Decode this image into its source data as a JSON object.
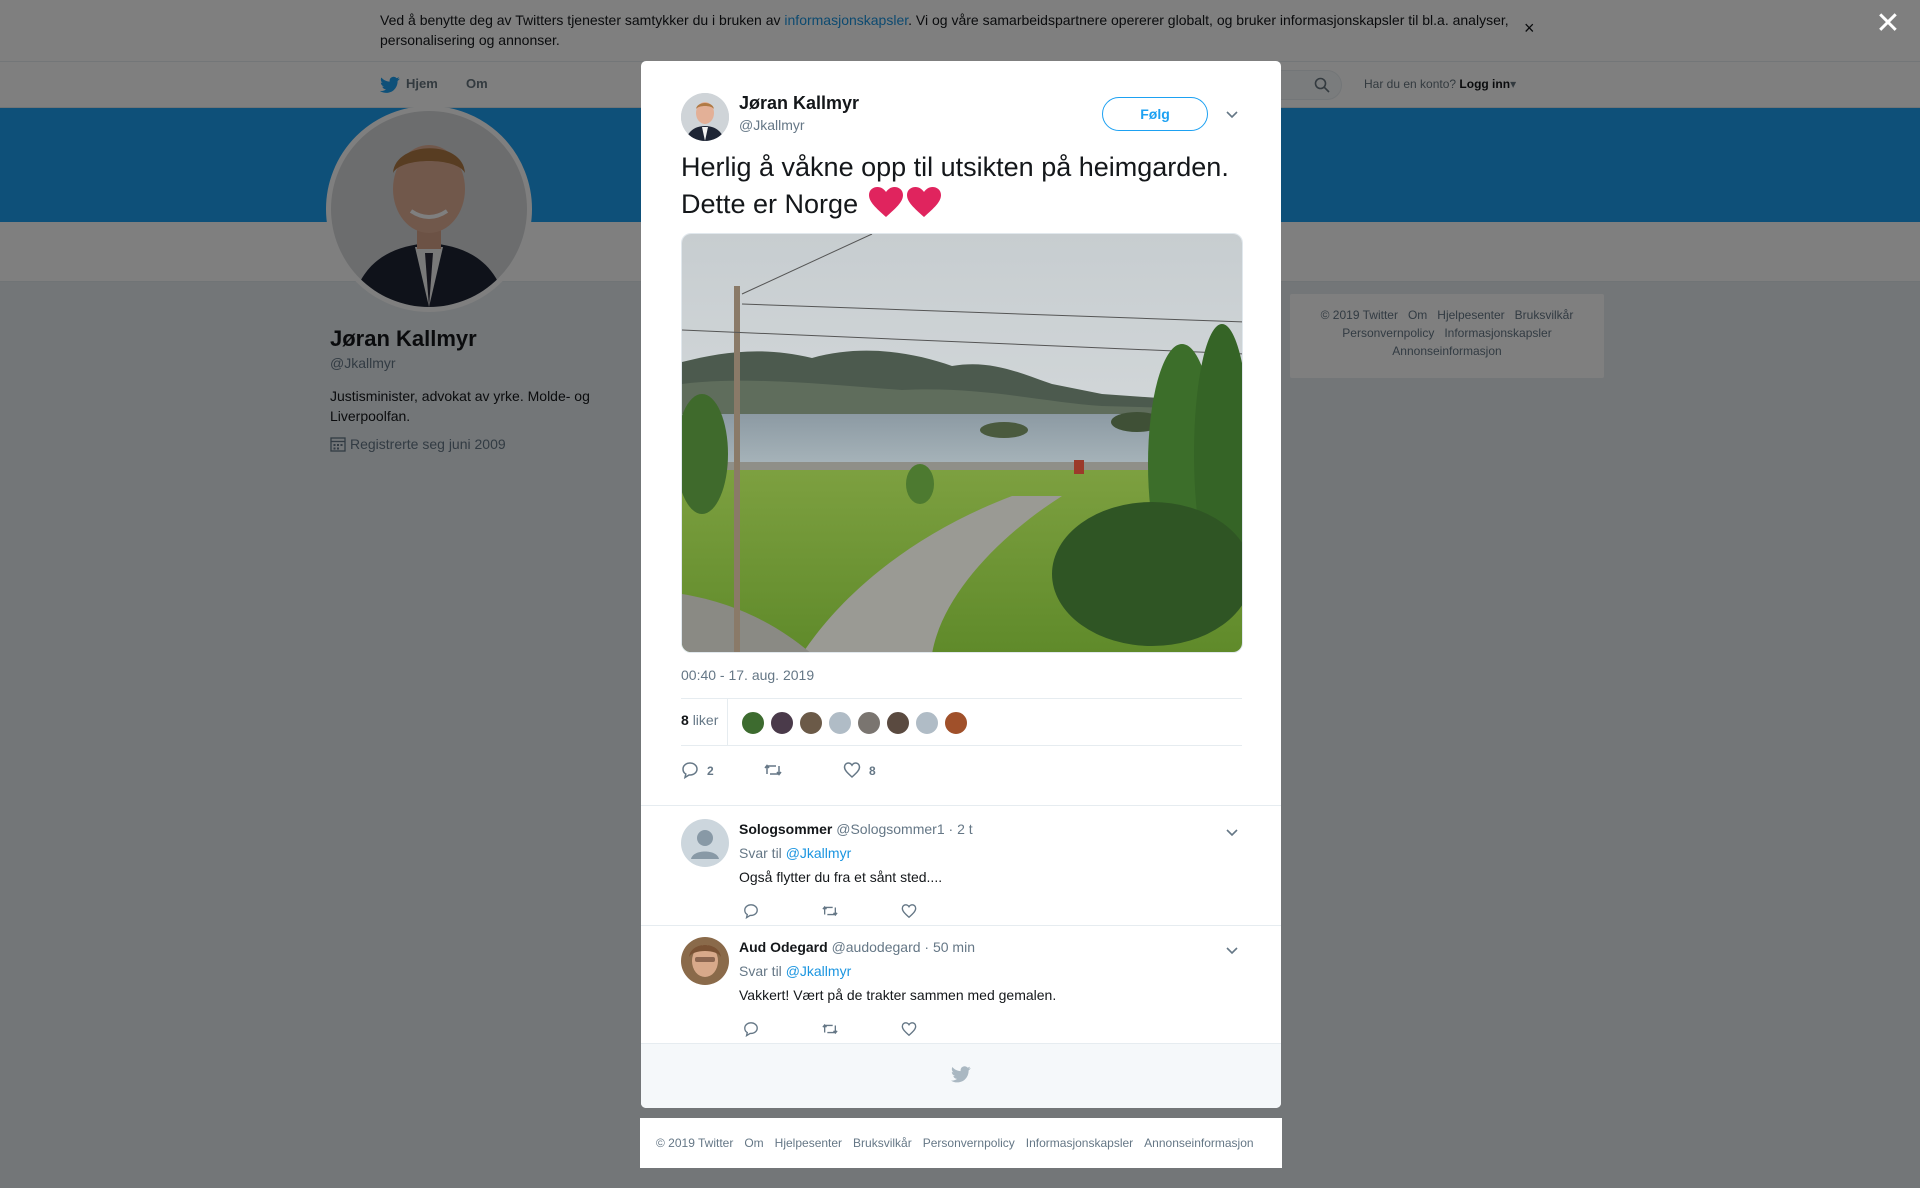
{
  "cookie_banner": {
    "text_before": "Ved å benytte deg av Twitters tjenester samtykker du i bruken av ",
    "link": "informasjonskapsler",
    "text_after": ". Vi og våre samarbeidspartnere opererer globalt, og bruker informasjonskapsler til bl.a. analyser, personalisering og annonser.",
    "close": "×"
  },
  "nav": {
    "home": "Hjem",
    "about": "Om",
    "account_prompt": "Har du en konto?",
    "login": "Logg inn",
    "login_caret": "▾"
  },
  "profile": {
    "name": "Jøran Kallmyr",
    "handle": "@Jkallmyr",
    "bio": "Justisminister, advokat av yrke. Molde- og Liverpoolfan.",
    "joined": "Registrerte seg juni 2009"
  },
  "side_footer": {
    "items": [
      "© 2019 Twitter",
      "Om",
      "Hjelpesenter",
      "Bruksvilkår",
      "Personvernpolicy",
      "Informasjonskapsler",
      "Annonseinformasjon"
    ]
  },
  "overlay_close": "✕",
  "tweet": {
    "author_name": "Jøran Kallmyr",
    "author_handle": "@Jkallmyr",
    "follow_label": "Følg",
    "text": "Herlig å våkne opp til utsikten på heimgarden. Dette er Norge",
    "emoji": "heart-emoji x2",
    "timestamp": "00:40 - 17. aug. 2019",
    "likes_number": "8",
    "likes_word": "liker",
    "reply_count": "2",
    "retweet_count": "",
    "like_count": "8",
    "liker_avatar_colors": [
      "#3d6b2f",
      "#4a3a4a",
      "#6b5a48",
      "#b0bcc6",
      "#7a7570",
      "#5a4a40",
      "#b0bcc6",
      "#a0502a"
    ]
  },
  "replies": [
    {
      "name": "Sologsommer",
      "handle": "@Sologsommer1",
      "time": "· 2 t",
      "reply_to_label": "Svar til",
      "reply_to_handle": "@Jkallmyr",
      "text": "Også flytter du fra et sånt sted...."
    },
    {
      "name": "Aud Odegard",
      "handle": "@audodegard",
      "time": "· 50 min",
      "reply_to_label": "Svar til",
      "reply_to_handle": "@Jkallmyr",
      "text": "Vakkert! Vært på de trakter sammen med gemalen."
    }
  ],
  "bottom_footer": {
    "items": [
      "© 2019 Twitter",
      "Om",
      "Hjelpesenter",
      "Bruksvilkår",
      "Personvernpolicy",
      "Informasjonskapsler",
      "Annonseinformasjon"
    ]
  },
  "colors": {
    "twitter_blue": "#1da1f2",
    "link_blue": "#1b95e0",
    "heart_red": "#e0245e",
    "muted_text": "#657786"
  }
}
